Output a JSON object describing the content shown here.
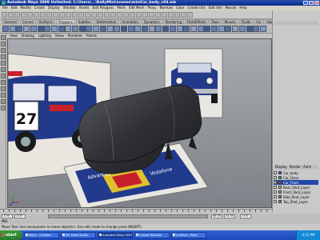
{
  "window": {
    "title": "Autodesk Maya 2009 Unlimited: C:\\Users\\...\\RallyMini\\scenes\\miniCar_body_v04.mb"
  },
  "menubar": {
    "items": [
      "File",
      "Edit",
      "Modify",
      "Create",
      "Display",
      "Window",
      "Assets",
      "Edit Polygons",
      "Mesh",
      "Edit Mesh",
      "Proxy",
      "Normals",
      "Color",
      "Create UVs",
      "Edit UVs",
      "Muscle",
      "Help"
    ]
  },
  "shelf": {
    "tabs": [
      "General",
      "Curves",
      "Surfaces",
      "Polygons",
      "Subdivs",
      "Deformation",
      "Animation",
      "Dynamics",
      "Rendering",
      "PaintEffects",
      "Toon",
      "Muscle",
      "Fluids",
      "Fur",
      "Hair",
      "nCloth",
      "Custom"
    ],
    "active_tab": "Polygons"
  },
  "viewport": {
    "menu": [
      "View",
      "Shading",
      "Lighting",
      "Show",
      "Renderer",
      "Panels"
    ],
    "reference_number": "27"
  },
  "layers": {
    "tabs": [
      "Display",
      "Render",
      "Anim"
    ],
    "rows": [
      {
        "label": "Car_body",
        "color": "#2850d8",
        "selected": false
      },
      {
        "label": "Car_Glass",
        "color": "#40a040",
        "selected": false
      },
      {
        "label": "Car_Front",
        "color": "#c03030",
        "selected": true
      },
      {
        "label": "Rear_Shot_Layer",
        "color": "#d0c040",
        "selected": false
      },
      {
        "label": "Front_Shot_Layer",
        "color": "#60a0c0",
        "selected": false
      },
      {
        "label": "Side_Shot_Layer",
        "color": "#a050a0",
        "selected": false
      },
      {
        "label": "Top_Shot_Layer",
        "color": "#808080",
        "selected": false
      }
    ]
  },
  "timeline": {
    "start": "1.00",
    "end": "24.00",
    "range_start": "1.00",
    "range_end": "48.00",
    "current_frame": "1.00"
  },
  "cmdline": {
    "label": "MEL"
  },
  "helpline": {
    "text": "Move Tool: Use manipulator to move object(s). Use edit mode to change pivot (INSERT)."
  },
  "taskbar": {
    "start_label": "start",
    "tasks": [
      {
        "label": "Maya - Untitled",
        "active": false
      },
      {
        "label": "3D Artist Studio",
        "active": false
      },
      {
        "label": "Autodesk Maya 2009",
        "active": true
      },
      {
        "label": "Output Window",
        "active": false
      },
      {
        "label": "untitled - Paint",
        "active": false
      }
    ],
    "clock": "4:12 PM"
  },
  "colors": {
    "car_blue": "#223a8c",
    "car_red": "#c8202a",
    "proxy_mesh": "#3b3d40"
  }
}
